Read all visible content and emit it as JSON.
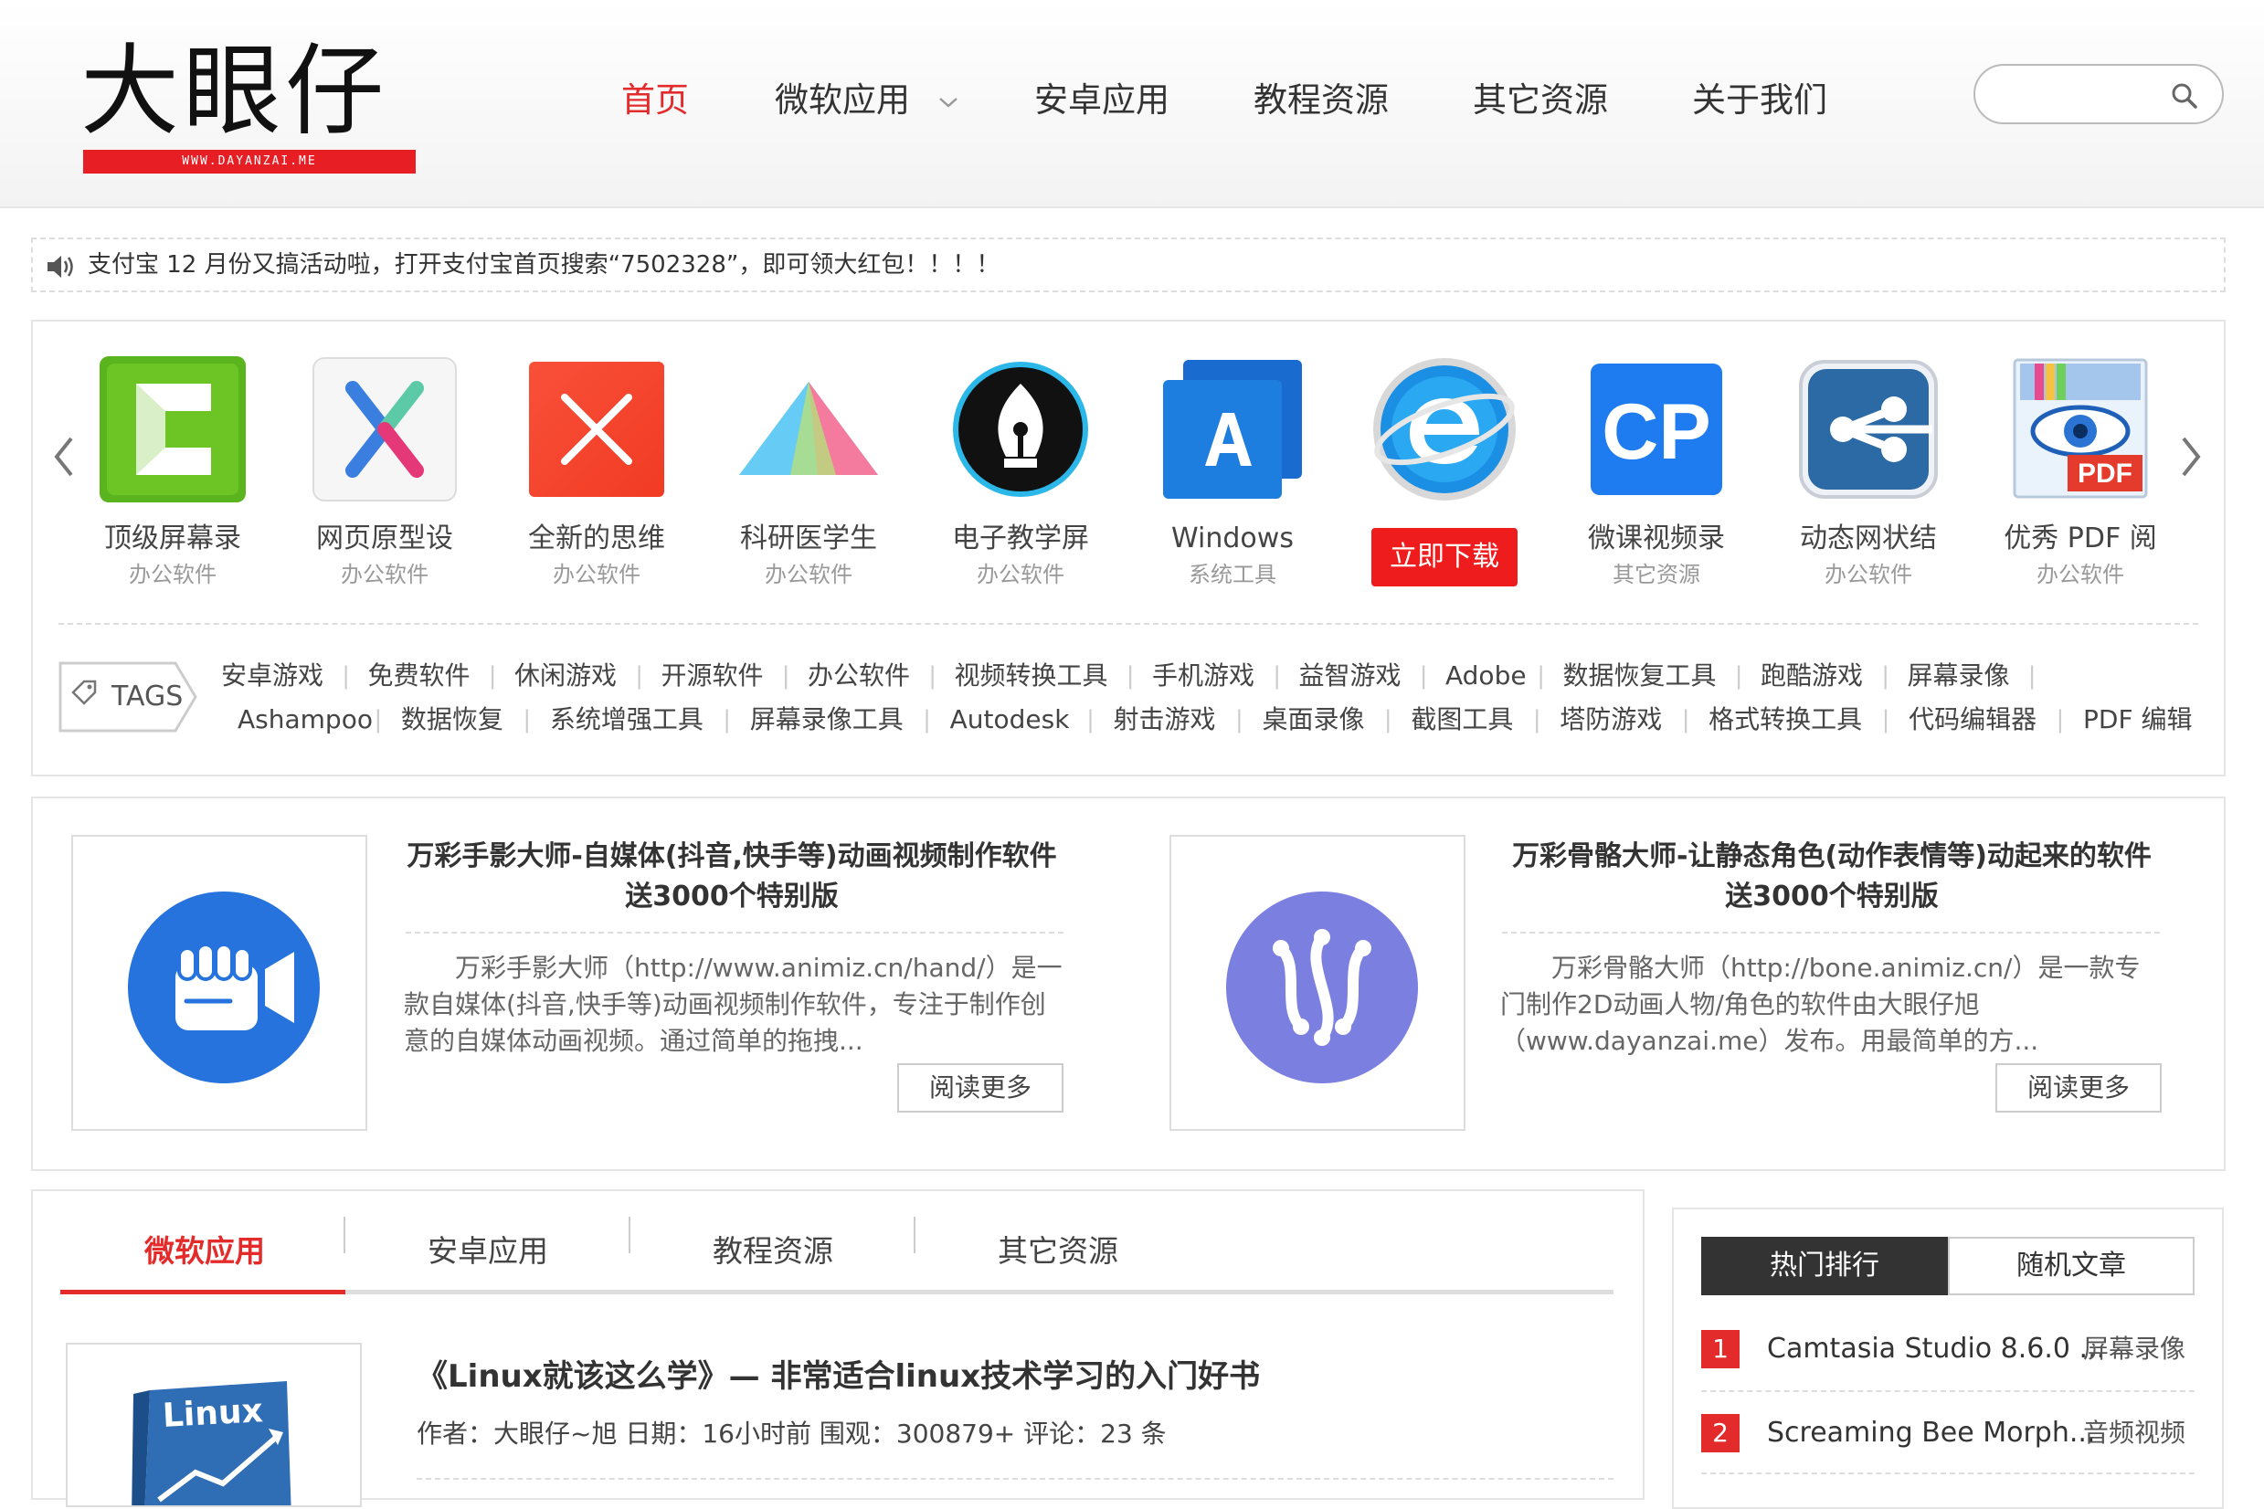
{
  "header": {
    "logo_text": "大眼仔",
    "logo_url_text": "WWW.DAYANZAI.ME",
    "nav": [
      {
        "label": "首页",
        "active": true
      },
      {
        "label": "微软应用",
        "has_dropdown": true
      },
      {
        "label": "安卓应用"
      },
      {
        "label": "教程资源"
      },
      {
        "label": "其它资源"
      },
      {
        "label": "关于我们"
      }
    ],
    "search_placeholder": ""
  },
  "notice": {
    "text": "支付宝 12 月份又搞活动啦，打开支付宝首页搜索“7502328”，即可领大红包！！！！"
  },
  "apps": [
    {
      "name": "顶级屏幕录",
      "category": "办公软件",
      "icon": "camtasia-icon"
    },
    {
      "name": "网页原型设",
      "category": "办公软件",
      "icon": "axure-icon"
    },
    {
      "name": "全新的思维",
      "category": "办公软件",
      "icon": "xmind-icon"
    },
    {
      "name": "科研医学生",
      "category": "办公软件",
      "icon": "prism-icon"
    },
    {
      "name": "电子教学屏",
      "category": "办公软件",
      "icon": "pen-nib-icon"
    },
    {
      "name": "Windows",
      "category": "系统工具",
      "icon": "acronis-icon"
    },
    {
      "name": "",
      "category": "",
      "icon": "ie-icon",
      "button": "立即下载"
    },
    {
      "name": "微课视频录",
      "category": "其它资源",
      "icon": "cp-icon"
    },
    {
      "name": "动态网状结",
      "category": "办公软件",
      "icon": "network-icon"
    },
    {
      "name": "优秀 PDF 阅",
      "category": "办公软件",
      "icon": "pdf-eye-icon"
    }
  ],
  "tags": {
    "label": "TAGS",
    "row1": [
      "安卓游戏",
      "免费软件",
      "休闲游戏",
      "开源软件",
      "办公软件",
      "视频转换工具",
      "手机游戏",
      "益智游戏",
      "Adobe",
      "数据恢复工具",
      "跑酷游戏",
      "屏幕录像"
    ],
    "row2": [
      "Ashampoo",
      "数据恢复",
      "系统增强工具",
      "屏幕录像工具",
      "Autodesk",
      "射击游戏",
      "桌面录像",
      "截图工具",
      "塔防游戏",
      "格式转换工具",
      "代码编辑器",
      "PDF 编辑"
    ]
  },
  "featured": [
    {
      "title_line1": "万彩手影大师-自媒体(抖音,快手等)动画视频制作软件",
      "title_line2": "送3000个特别版",
      "desc": "万彩手影大师（http://www.animiz.cn/hand/）是一款自媒体(抖音,快手等)动画视频制作软件，专注于制作创意的自媒体动画视频。通过简单的拖拽...",
      "button": "阅读更多",
      "icon": "video-fist-icon",
      "color": "#2673dd"
    },
    {
      "title_line1": "万彩骨骼大师-让静态角色(动作表情等)动起来的软件",
      "title_line2": "送3000个特别版",
      "desc": "万彩骨骼大师（http://bone.animiz.cn/）是一款专门制作2D动画人物/角色的软件由大眼仔旭（www.dayanzai.me）发布。用最简单的方...",
      "button": "阅读更多",
      "icon": "bones-icon",
      "color": "#7b7fe0"
    }
  ],
  "main_tabs": [
    {
      "label": "微软应用",
      "active": true
    },
    {
      "label": "安卓应用"
    },
    {
      "label": "教程资源"
    },
    {
      "label": "其它资源"
    }
  ],
  "post": {
    "title": "《Linux就该这么学》— 非常适合linux技术学习的入门好书",
    "meta": "作者：大眼仔~旭 日期：16小时前 围观：300879+ 评论：23 条",
    "thumb_text": "Linux"
  },
  "sidebar": {
    "tabs": [
      "热门排行",
      "随机文章"
    ],
    "items": [
      {
        "rank": "1",
        "title": "Camtasia Studio 8.6.0 ...",
        "category": "屏幕录像"
      },
      {
        "rank": "2",
        "title": "Screaming Bee Morph...",
        "category": "音频视频"
      }
    ]
  },
  "colors": {
    "accent": "#e42b2b",
    "download_button": "#ee1c1c"
  }
}
